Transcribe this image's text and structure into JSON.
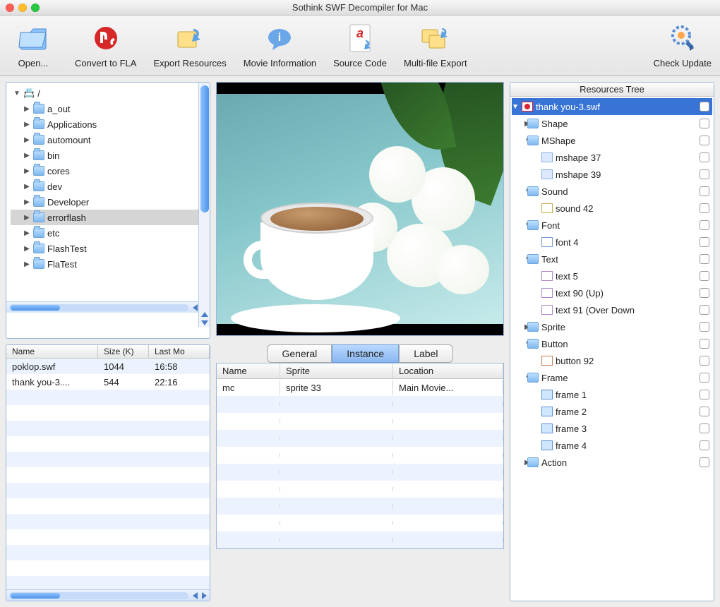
{
  "window": {
    "title": "Sothink SWF Decompiler for Mac"
  },
  "toolbar": {
    "open": "Open...",
    "convert": "Convert to FLA",
    "export": "Export Resources",
    "movieinfo": "Movie Information",
    "source": "Source Code",
    "multifile": "Multi-file Export",
    "update": "Check Update"
  },
  "fileTree": {
    "root": "/",
    "items": [
      {
        "name": "a_out"
      },
      {
        "name": "Applications"
      },
      {
        "name": "automount"
      },
      {
        "name": "bin"
      },
      {
        "name": "cores"
      },
      {
        "name": "dev"
      },
      {
        "name": "Developer"
      },
      {
        "name": "errorflash",
        "selected": true
      },
      {
        "name": "etc"
      },
      {
        "name": "FlashTest"
      },
      {
        "name": "FlaTest"
      }
    ]
  },
  "fileTable": {
    "headers": {
      "name": "Name",
      "size": "Size (K)",
      "mod": "Last Mo"
    },
    "rows": [
      {
        "name": "poklop.swf",
        "size": "1044",
        "mod": "16:58"
      },
      {
        "name": "thank you-3....",
        "size": "544",
        "mod": "22:16"
      }
    ]
  },
  "tabs": {
    "general": "General",
    "instance": "Instance",
    "label": "Label",
    "active": "instance"
  },
  "instanceTable": {
    "headers": {
      "name": "Name",
      "sprite": "Sprite",
      "loc": "Location"
    },
    "rows": [
      {
        "name": "mc",
        "sprite": "sprite 33",
        "loc": "Main Movie..."
      }
    ]
  },
  "resources": {
    "title": "Resources Tree",
    "root": "thank you-3.swf",
    "groups": [
      {
        "label": "Shape",
        "expanded": false,
        "children": []
      },
      {
        "label": "MShape",
        "expanded": true,
        "children": [
          {
            "label": "mshape 37",
            "icon": "shape"
          },
          {
            "label": "mshape 39",
            "icon": "shape"
          }
        ]
      },
      {
        "label": "Sound",
        "expanded": true,
        "children": [
          {
            "label": "sound 42",
            "icon": "snd"
          }
        ]
      },
      {
        "label": "Font",
        "expanded": true,
        "children": [
          {
            "label": "font 4",
            "icon": "font"
          }
        ]
      },
      {
        "label": "Text",
        "expanded": true,
        "children": [
          {
            "label": "text 5",
            "icon": "txt"
          },
          {
            "label": "text 90 (Up)",
            "icon": "txt"
          },
          {
            "label": "text 91 (Over Down",
            "icon": "txt"
          }
        ]
      },
      {
        "label": "Sprite",
        "expanded": false,
        "children": []
      },
      {
        "label": "Button",
        "expanded": true,
        "children": [
          {
            "label": "button 92",
            "icon": "btn"
          }
        ]
      },
      {
        "label": "Frame",
        "expanded": true,
        "children": [
          {
            "label": "frame 1",
            "icon": "frm"
          },
          {
            "label": "frame 2",
            "icon": "frm"
          },
          {
            "label": "frame 3",
            "icon": "frm"
          },
          {
            "label": "frame 4",
            "icon": "frm"
          }
        ]
      },
      {
        "label": "Action",
        "expanded": false,
        "children": []
      }
    ]
  }
}
